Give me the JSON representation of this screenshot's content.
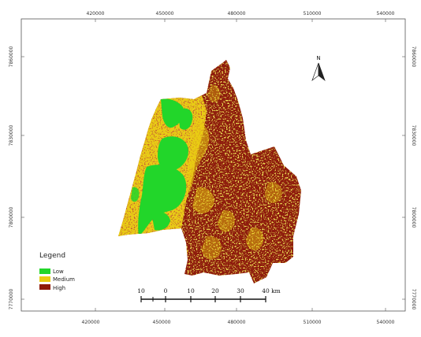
{
  "map": {
    "x_ticks_top": [
      "420000",
      "450000",
      "480000",
      "510000",
      "540000"
    ],
    "x_ticks_bottom": [
      "420000",
      "450000",
      "480000",
      "510000",
      "540000"
    ],
    "y_ticks_left": [
      "7860000",
      "7830000",
      "7800000",
      "7770000"
    ],
    "y_ticks_right": [
      "7860000",
      "7830000",
      "7800000",
      "7770000"
    ],
    "colors": {
      "low": "#22d62a",
      "medium": "#e9cc12",
      "high": "#8f1a08"
    }
  },
  "legend": {
    "title": "Legend",
    "items": [
      {
        "label": "Low",
        "color": "#22d62a"
      },
      {
        "label": "Medium",
        "color": "#e9cc12"
      },
      {
        "label": "High",
        "color": "#8f1a08"
      }
    ]
  },
  "scale_bar": {
    "labels": [
      "10",
      "0",
      "10",
      "20",
      "30",
      "40 km"
    ]
  },
  "north_arrow": {
    "label": "N"
  }
}
